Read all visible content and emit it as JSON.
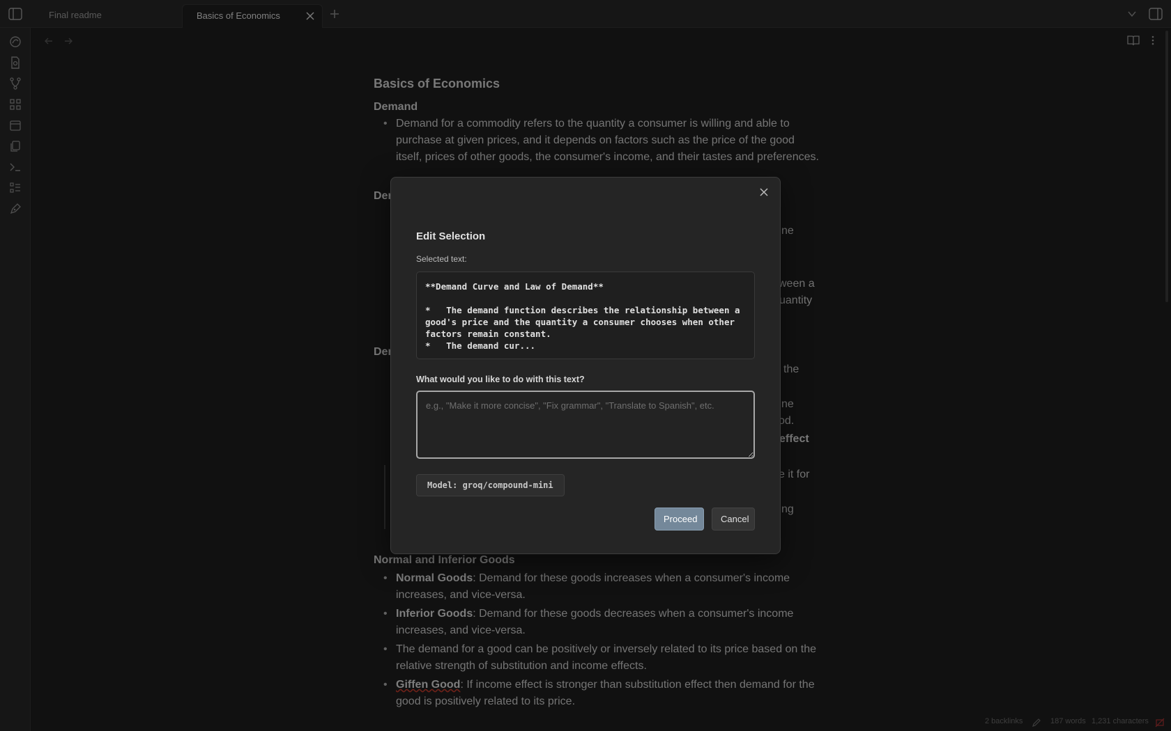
{
  "tabs": [
    {
      "label": "Final readme"
    },
    {
      "label": "Basics of Economics"
    }
  ],
  "doc": {
    "title": "Basics of Economics",
    "demand_heading": "Demand",
    "demand_bullet": "Demand for a commodity refers to the quantity a consumer is willing and able to purchase at given prices, and it depends on factors such as the price of the good itself, prices of other goods, the consumer's income, and their tastes and preferences.",
    "frag_de1": "Der",
    "frag_ne": "ne",
    "frag_ween_a": "ween a",
    "frag_uantity": "uantity",
    "frag_de2": "Der",
    "frag_the": "the",
    "frag_ne2": "ne",
    "frag_od": "od.",
    "frag_effect": "effect",
    "frag_e_it_for": "e it for",
    "frag_ng": "ng",
    "goods_heading": "Normal and Inferior Goods",
    "normal_label": "Normal Goods",
    "normal_text": ": Demand for these goods increases when a consumer's income increases, and vice-versa.",
    "inferior_label": "Inferior Goods",
    "inferior_text": ": Demand for these goods decreases when a consumer's income increases, and vice-versa.",
    "relation_text": "The demand for a good can be positively or inversely related to its price based on the relative strength of substitution and income effects.",
    "giffen_label": "Giffen Good",
    "giffen_text": ": If income effect is stronger than substitution effect then demand for the good is positively related to its price."
  },
  "modal": {
    "title": "Edit Selection",
    "selected_label": "Selected text:",
    "selected_text": "**Demand Curve and Law of Demand**\n\n*   The demand function describes the relationship between a good's price and the quantity a consumer chooses when other factors remain constant.\n*   The demand cur...",
    "prompt_label": "What would you like to do with this text?",
    "prompt_value": "",
    "prompt_placeholder": "e.g., \"Make it more concise\", \"Fix grammar\", \"Translate to Spanish\", etc.",
    "model_label": "Model: groq/compound-mini",
    "proceed_label": "Proceed",
    "cancel_label": "Cancel"
  },
  "status": {
    "backlinks": "2 backlinks",
    "words": "187 words",
    "characters": "1,231 characters"
  },
  "colors": {
    "background": "#1e1e1e",
    "modal": "#252525",
    "proceed": "#74889a"
  }
}
